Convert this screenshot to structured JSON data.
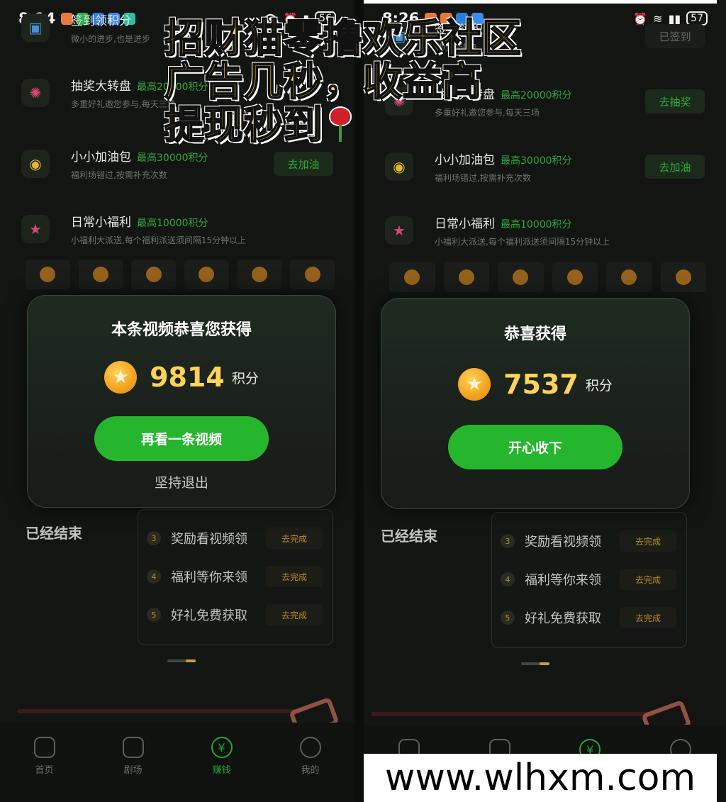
{
  "left_phone": {
    "status": {
      "time": "8:14",
      "battery": "56"
    },
    "tasks": [
      {
        "name": "签到领积分",
        "points": "",
        "desc": "微小的进步,也是进步",
        "button": ""
      },
      {
        "name": "抽奖大转盘",
        "points": "最高20000积分",
        "desc": "多重好礼邀您参与,每天三场",
        "button": ""
      },
      {
        "name": "小小加油包",
        "points": "最高30000积分",
        "desc": "福利场错过,按需补充次数",
        "button": "去加油"
      },
      {
        "name": "日常小福利",
        "points": "最高10000积分",
        "desc": "小福利大派送,每个福利派送须间隔15分钟以上",
        "button": ""
      }
    ],
    "modal": {
      "title": "本条视频恭喜您获得",
      "amount": "9814",
      "unit": "积分",
      "primary_button": "再看一条视频",
      "secondary_link": "坚持退出"
    },
    "ended_label": "已经结束",
    "panel_rows": [
      {
        "num": "3",
        "label": "奖励看视频领",
        "action": "去完成"
      },
      {
        "num": "4",
        "label": "福利等你来领",
        "action": "去完成"
      },
      {
        "num": "5",
        "label": "好礼免费获取",
        "action": "去完成"
      }
    ],
    "nav": [
      {
        "label": "首页",
        "icon": "home-icon"
      },
      {
        "label": "剧场",
        "icon": "play-icon"
      },
      {
        "label": "赚钱",
        "icon": "yuan-icon"
      },
      {
        "label": "我的",
        "icon": "user-icon"
      }
    ]
  },
  "right_phone": {
    "status": {
      "time": "8:26",
      "battery": "57"
    },
    "tasks": [
      {
        "name": "签到领积分",
        "points": "",
        "desc": "微小的进步",
        "button": "已签到"
      },
      {
        "name": "抽奖大转盘",
        "points": "最高20000积分",
        "desc": "多重好礼邀您参与,每天三场",
        "button": "去抽奖"
      },
      {
        "name": "小小加油包",
        "points": "最高30000积分",
        "desc": "福利场错过,按需补充次数",
        "button": "去加油"
      },
      {
        "name": "日常小福利",
        "points": "最高10000积分",
        "desc": "小福利大派送,每个福利派送须间隔15分钟以上",
        "button": ""
      }
    ],
    "modal": {
      "title": "恭喜获得",
      "amount": "7537",
      "unit": "积分",
      "primary_button": "开心收下"
    },
    "ended_label": "已经结束",
    "panel_rows": [
      {
        "num": "3",
        "label": "奖励看视频领",
        "action": "去完成"
      },
      {
        "num": "4",
        "label": "福利等你来领",
        "action": "去完成"
      },
      {
        "num": "5",
        "label": "好礼免费获取",
        "action": "去完成"
      }
    ]
  },
  "overlay": {
    "line1": "招财猫零撸欢乐社区",
    "line2": "广告几秒，收益高",
    "line3": "提现秒到"
  },
  "watermark": "www.wlhxm.com",
  "colors": {
    "accent_green": "#25b62e",
    "gold": "#ffd25a",
    "overlay_yellow": "#f4e03c"
  }
}
